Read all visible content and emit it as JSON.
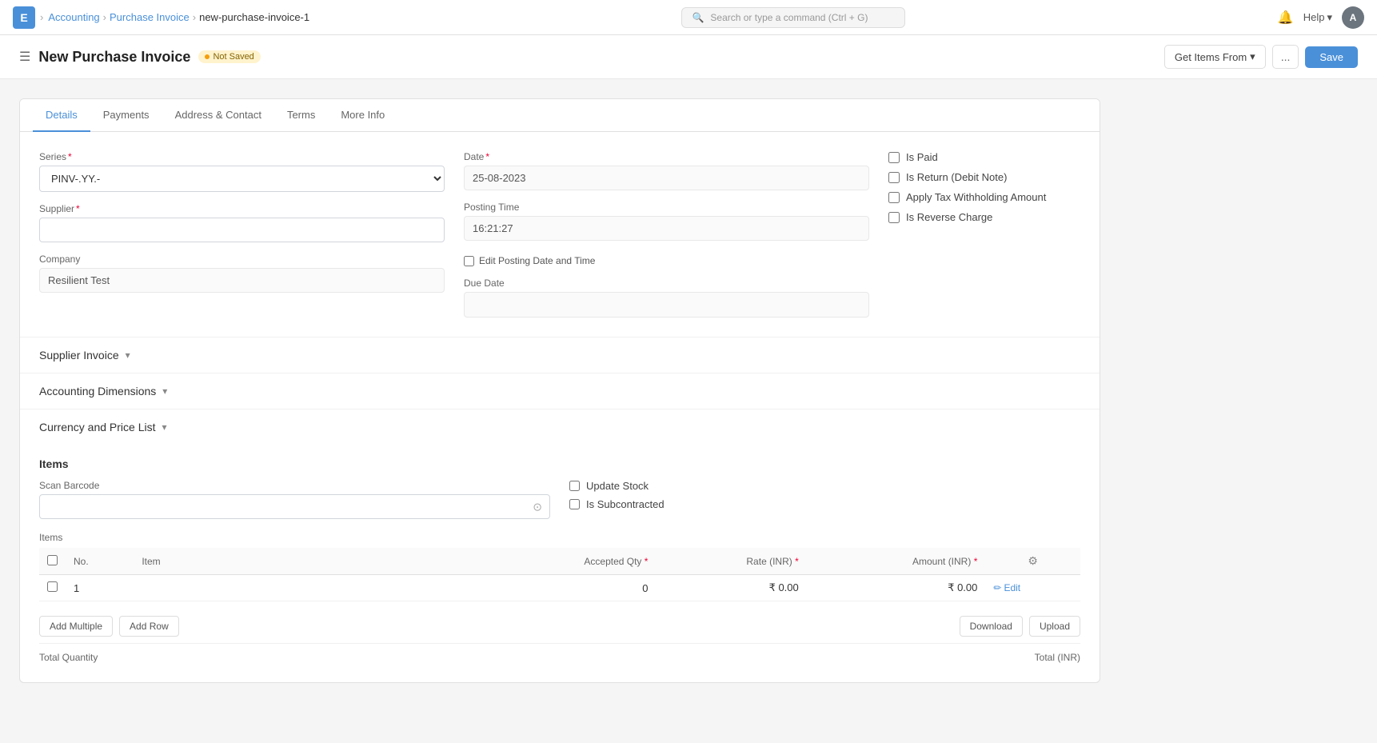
{
  "app": {
    "logo": "E",
    "logo_bg": "#4a90d9"
  },
  "breadcrumb": {
    "items": [
      "Accounting",
      "Purchase Invoice",
      "new-purchase-invoice-1"
    ]
  },
  "search": {
    "placeholder": "Search or type a command (Ctrl + G)"
  },
  "nav": {
    "help_label": "Help",
    "avatar_label": "A"
  },
  "header": {
    "title": "New Purchase Invoice",
    "status": "Not Saved",
    "get_items_label": "Get Items From",
    "more_label": "...",
    "save_label": "Save"
  },
  "tabs": [
    {
      "id": "details",
      "label": "Details",
      "active": true
    },
    {
      "id": "payments",
      "label": "Payments",
      "active": false
    },
    {
      "id": "address",
      "label": "Address & Contact",
      "active": false
    },
    {
      "id": "terms",
      "label": "Terms",
      "active": false
    },
    {
      "id": "more_info",
      "label": "More Info",
      "active": false
    }
  ],
  "form": {
    "series_label": "Series",
    "series_value": "PINV-.YY.-",
    "supplier_label": "Supplier",
    "supplier_placeholder": "",
    "company_label": "Company",
    "company_value": "Resilient Test",
    "date_label": "Date",
    "date_value": "25-08-2023",
    "posting_time_label": "Posting Time",
    "posting_time_value": "16:21:27",
    "edit_posting_label": "Edit Posting Date and Time",
    "due_date_label": "Due Date",
    "is_paid_label": "Is Paid",
    "is_return_label": "Is Return (Debit Note)",
    "apply_tax_label": "Apply Tax Withholding Amount",
    "is_reverse_label": "Is Reverse Charge"
  },
  "sections": {
    "supplier_invoice": "Supplier Invoice",
    "accounting_dimensions": "Accounting Dimensions",
    "currency_price_list": "Currency and Price List"
  },
  "items_section": {
    "title": "Items",
    "scan_barcode_label": "Scan Barcode",
    "scan_placeholder": "",
    "update_stock_label": "Update Stock",
    "is_subcontracted_label": "Is Subcontracted"
  },
  "table": {
    "label": "Items",
    "columns": [
      {
        "id": "no",
        "label": "No."
      },
      {
        "id": "item",
        "label": "Item"
      },
      {
        "id": "accepted_qty",
        "label": "Accepted Qty"
      },
      {
        "id": "rate_inr",
        "label": "Rate (INR)"
      },
      {
        "id": "amount_inr",
        "label": "Amount (INR)"
      },
      {
        "id": "settings",
        "label": ""
      }
    ],
    "rows": [
      {
        "no": "1",
        "item": "",
        "accepted_qty": "0",
        "rate_inr": "₹ 0.00",
        "amount_inr": "₹ 0.00",
        "action": "Edit"
      }
    ],
    "add_multiple_label": "Add Multiple",
    "add_row_label": "Add Row",
    "download_label": "Download",
    "upload_label": "Upload",
    "total_qty_label": "Total Quantity",
    "total_inr_label": "Total (INR)"
  }
}
